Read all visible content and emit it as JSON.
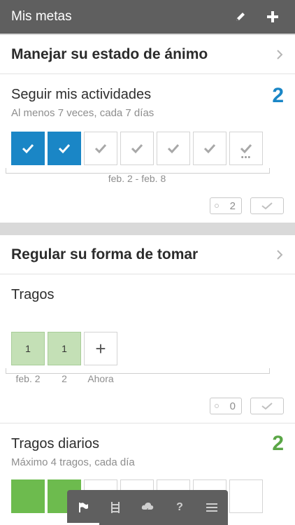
{
  "header": {
    "title": "Mis metas",
    "edit_icon": "pencil-icon",
    "add_icon": "plus-icon"
  },
  "colors": {
    "header_bg": "#5f5f5f",
    "done_blue": "#1a86c6",
    "drink_green": "#c4e0b6",
    "count_green": "#5aa646"
  },
  "card1": {
    "category": "Manejar su estado de ánimo",
    "goal": {
      "title": "Seguir mis actividades",
      "subtitle": "Al menos 7 veces, cada 7 días",
      "count": "2",
      "days": [
        "done",
        "done",
        "empty",
        "empty",
        "empty",
        "empty",
        "more"
      ],
      "week_range": "feb. 2 - feb. 8",
      "tag_count": "2"
    }
  },
  "card2": {
    "category": "Regular su forma de tomar",
    "goal1": {
      "title": "Tragos",
      "entries": [
        {
          "value": "1",
          "label": "feb. 2"
        },
        {
          "value": "1",
          "label": "2"
        }
      ],
      "add_label": "Ahora",
      "add_symbol": "+",
      "tag_count": "0"
    },
    "goal2": {
      "title": "Tragos diarios",
      "subtitle": "Máximo 4 tragos, cada día",
      "count": "2"
    }
  },
  "tabbar": {
    "items": [
      "flag-icon",
      "ladder-icon",
      "cloud-icon",
      "?",
      "menu-icon"
    ]
  }
}
